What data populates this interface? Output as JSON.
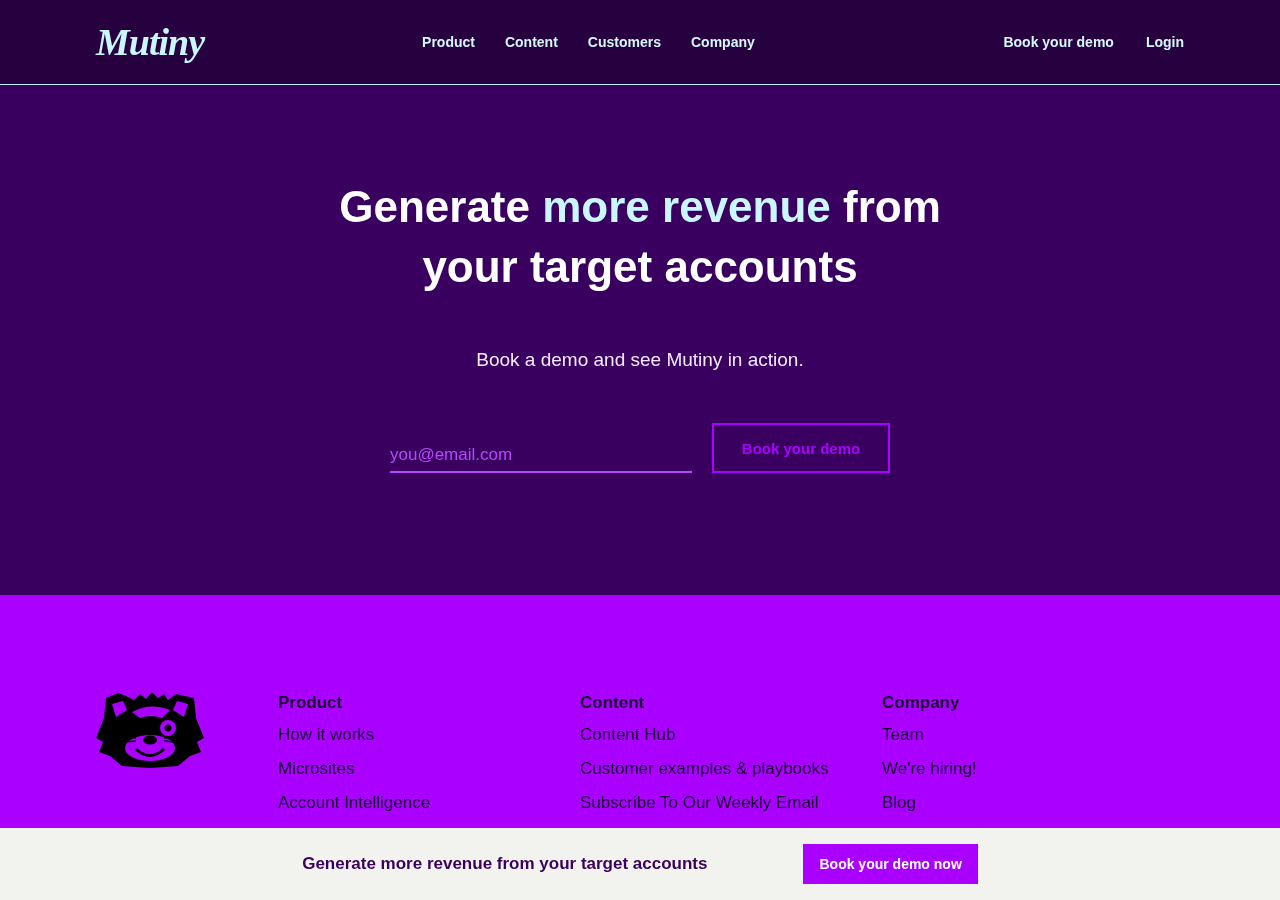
{
  "header": {
    "logo": "Mutiny",
    "nav": [
      "Product",
      "Content",
      "Customers",
      "Company"
    ],
    "actions": [
      "Book your demo",
      "Login"
    ]
  },
  "hero": {
    "headline": [
      {
        "text": "Generate ",
        "highlight": false
      },
      {
        "text": "more revenue",
        "highlight": true
      },
      {
        "text": " from your target accounts",
        "highlight": false
      }
    ],
    "subtitle": "Book a demo and see Mutiny in action.",
    "email_field": {
      "placeholder": "you@email.com"
    },
    "button": "Book your demo"
  },
  "footer": {
    "columns": [
      {
        "title": "Product",
        "links": [
          "How it works",
          "Microsites",
          "Account Intelligence"
        ]
      },
      {
        "title": "Content",
        "links": [
          "Content Hub",
          "Customer examples & playbooks",
          "Subscribe To Our Weekly Email"
        ]
      },
      {
        "title": "Company",
        "links": [
          "Team",
          "We're hiring!",
          "Blog"
        ]
      }
    ]
  },
  "sticky_bar": {
    "text": "Generate more revenue from your target accounts",
    "button": "Book your demo now"
  }
}
